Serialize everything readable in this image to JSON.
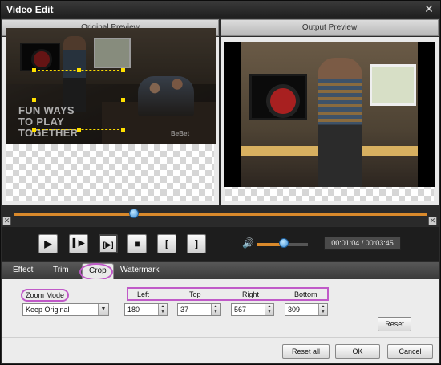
{
  "window": {
    "title": "Video Edit",
    "close_glyph": "✕"
  },
  "preview": {
    "original_label": "Original Preview",
    "output_label": "Output Preview",
    "overlay_lines": [
      "FUN WAYS",
      "TO PLAY",
      "TOGETHER"
    ],
    "brand_mark": "BeBet"
  },
  "timeline": {
    "position_fraction": 0.29
  },
  "playback": {
    "play_glyph": "▶",
    "step_glyph": "▌▶",
    "segment_glyph": "[▶]",
    "stop_glyph": "■",
    "mark_in_glyph": "[",
    "mark_out_glyph": "]",
    "volume_glyph": "🔊",
    "volume_fraction": 0.5,
    "timecode": "00:01:04 / 00:03:45"
  },
  "tabs": [
    {
      "label": "Effect"
    },
    {
      "label": "Trim"
    },
    {
      "label": "Crop"
    },
    {
      "label": "Watermark"
    }
  ],
  "crop": {
    "zoom_mode_label": "Zoom Mode",
    "zoom_mode_value": "Keep Original",
    "left_label": "Left",
    "top_label": "Top",
    "right_label": "Right",
    "bottom_label": "Bottom",
    "left_value": "180",
    "top_value": "37",
    "right_value": "567",
    "bottom_value": "309",
    "reset_label": "Reset"
  },
  "footer": {
    "reset_all_label": "Reset all",
    "ok_label": "OK",
    "cancel_label": "Cancel"
  },
  "colors": {
    "accent": "#d9892b",
    "highlight": "#c05ac8",
    "crop_frame": "#ffe000"
  }
}
